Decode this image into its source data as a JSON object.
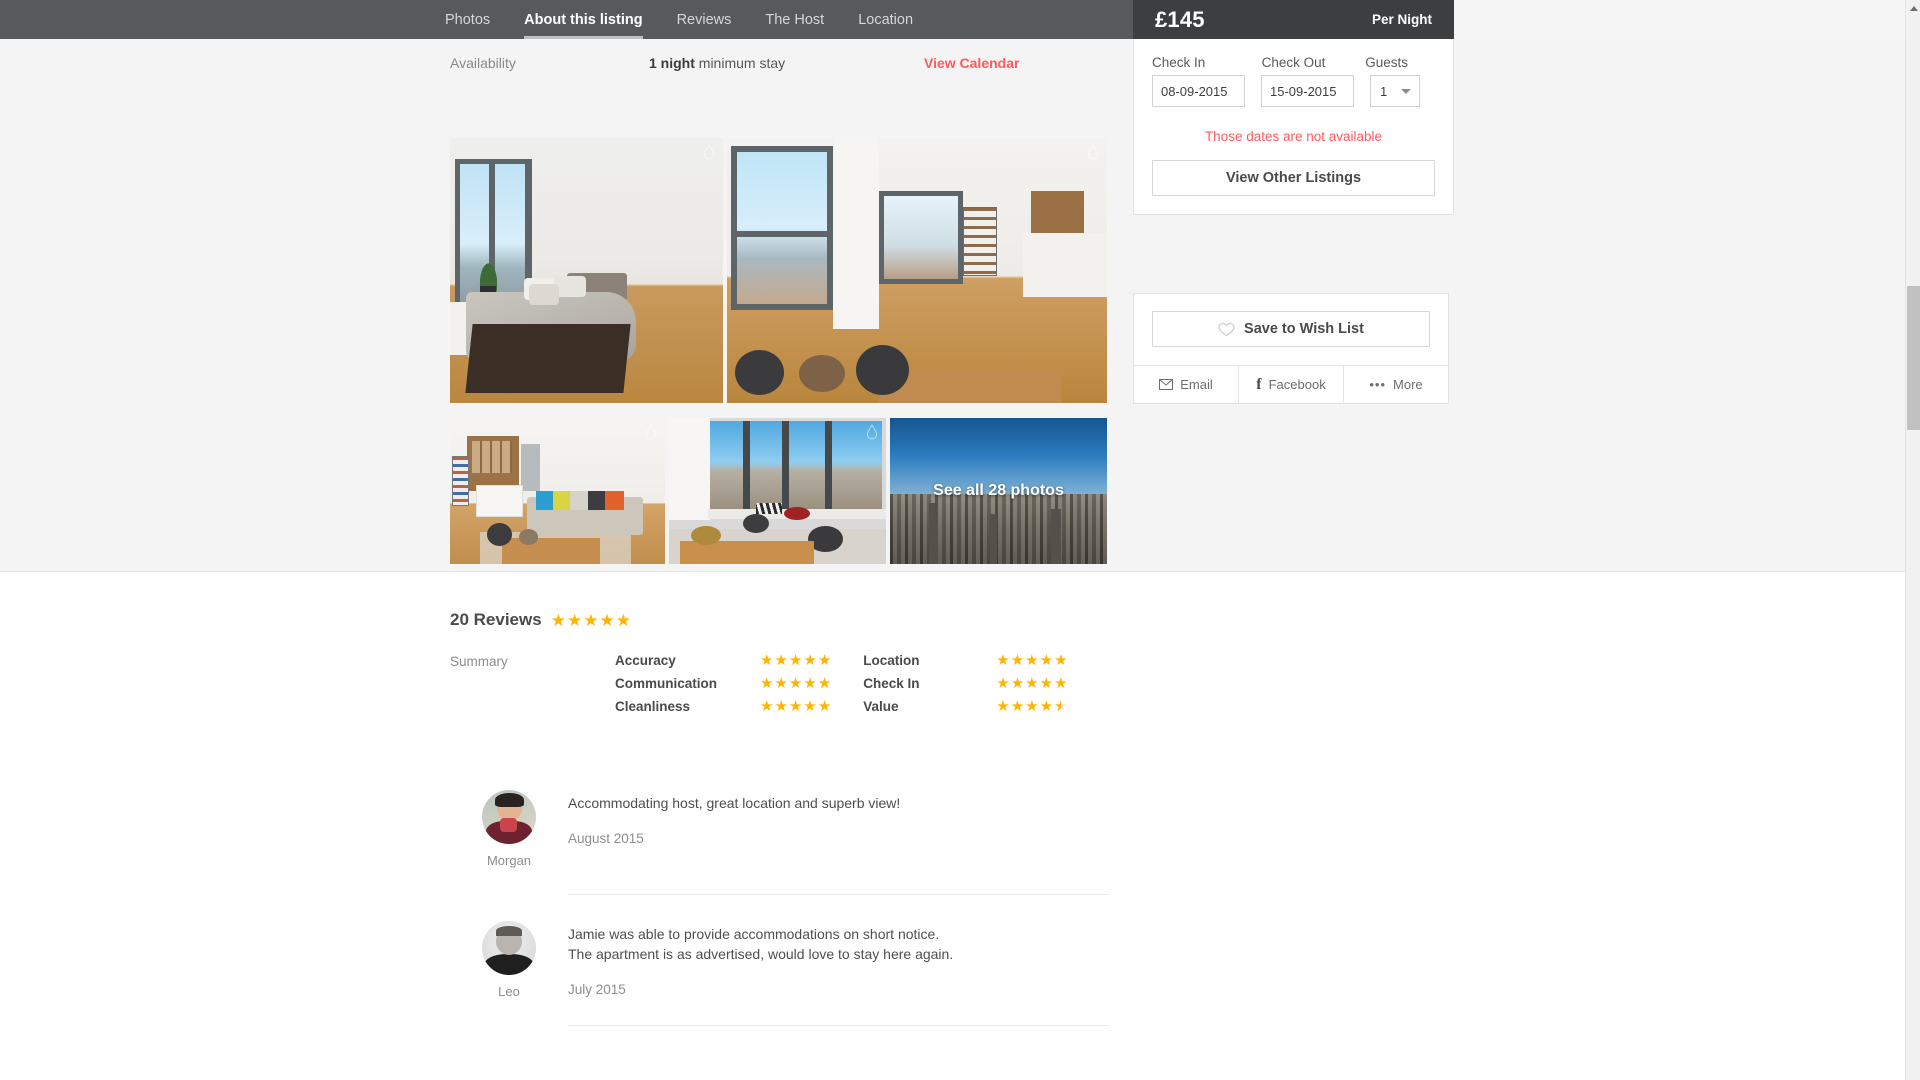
{
  "nav": {
    "items": [
      {
        "label": "Photos",
        "active": false
      },
      {
        "label": "About this listing",
        "active": true
      },
      {
        "label": "Reviews",
        "active": false
      },
      {
        "label": "The Host",
        "active": false
      },
      {
        "label": "Location",
        "active": false
      }
    ]
  },
  "price_bar": {
    "amount": "£145",
    "unit": "Per Night"
  },
  "availability": {
    "label": "Availability",
    "value_bold": "1 night",
    "value_rest": " minimum stay",
    "link": "View Calendar"
  },
  "gallery": {
    "see_all_label": "See all 28 photos",
    "photos": [
      {
        "alt": "bedroom-with-city-view"
      },
      {
        "alt": "living-area-with-bookshelf"
      },
      {
        "alt": "open-plan-living-room-sofa"
      },
      {
        "alt": "dining-table-by-windows"
      },
      {
        "alt": "city-skyline-aerial"
      }
    ]
  },
  "booking": {
    "checkin_label": "Check In",
    "checkout_label": "Check Out",
    "guests_label": "Guests",
    "checkin_value": "08-09-2015",
    "checkout_value": "15-09-2015",
    "guests_value": "1",
    "error_message": "Those dates are not available",
    "view_other_label": "View Other Listings"
  },
  "wishlist": {
    "save_label": "Save to Wish List",
    "share": [
      {
        "label": "Email",
        "icon": "envelope-icon"
      },
      {
        "label": "Facebook",
        "icon": "facebook-icon"
      },
      {
        "label": "More",
        "icon": "ellipsis-icon"
      }
    ]
  },
  "reviews": {
    "count_label": "20 Reviews",
    "overall_stars": 5,
    "summary_label": "Summary",
    "categories_left": [
      {
        "name": "Accuracy",
        "stars": 5
      },
      {
        "name": "Communication",
        "stars": 5
      },
      {
        "name": "Cleanliness",
        "stars": 5
      }
    ],
    "categories_right": [
      {
        "name": "Location",
        "stars": 5
      },
      {
        "name": "Check In",
        "stars": 5
      },
      {
        "name": "Value",
        "stars": 4.5
      }
    ],
    "items": [
      {
        "author": "Morgan",
        "text": "Accommodating host, great location and superb view!",
        "date": "August 2015"
      },
      {
        "author": "Leo",
        "text": "Jamie was able to provide accommodations on short notice. The apartment is as advertised, would love to stay here again.",
        "date": "July 2015"
      }
    ]
  },
  "colors": {
    "nav_bg": "#57595b",
    "price_bg": "#3c3e3f",
    "accent": "#ff5a5f",
    "star": "#ffb400",
    "page_bg": "#f4f4f4"
  }
}
